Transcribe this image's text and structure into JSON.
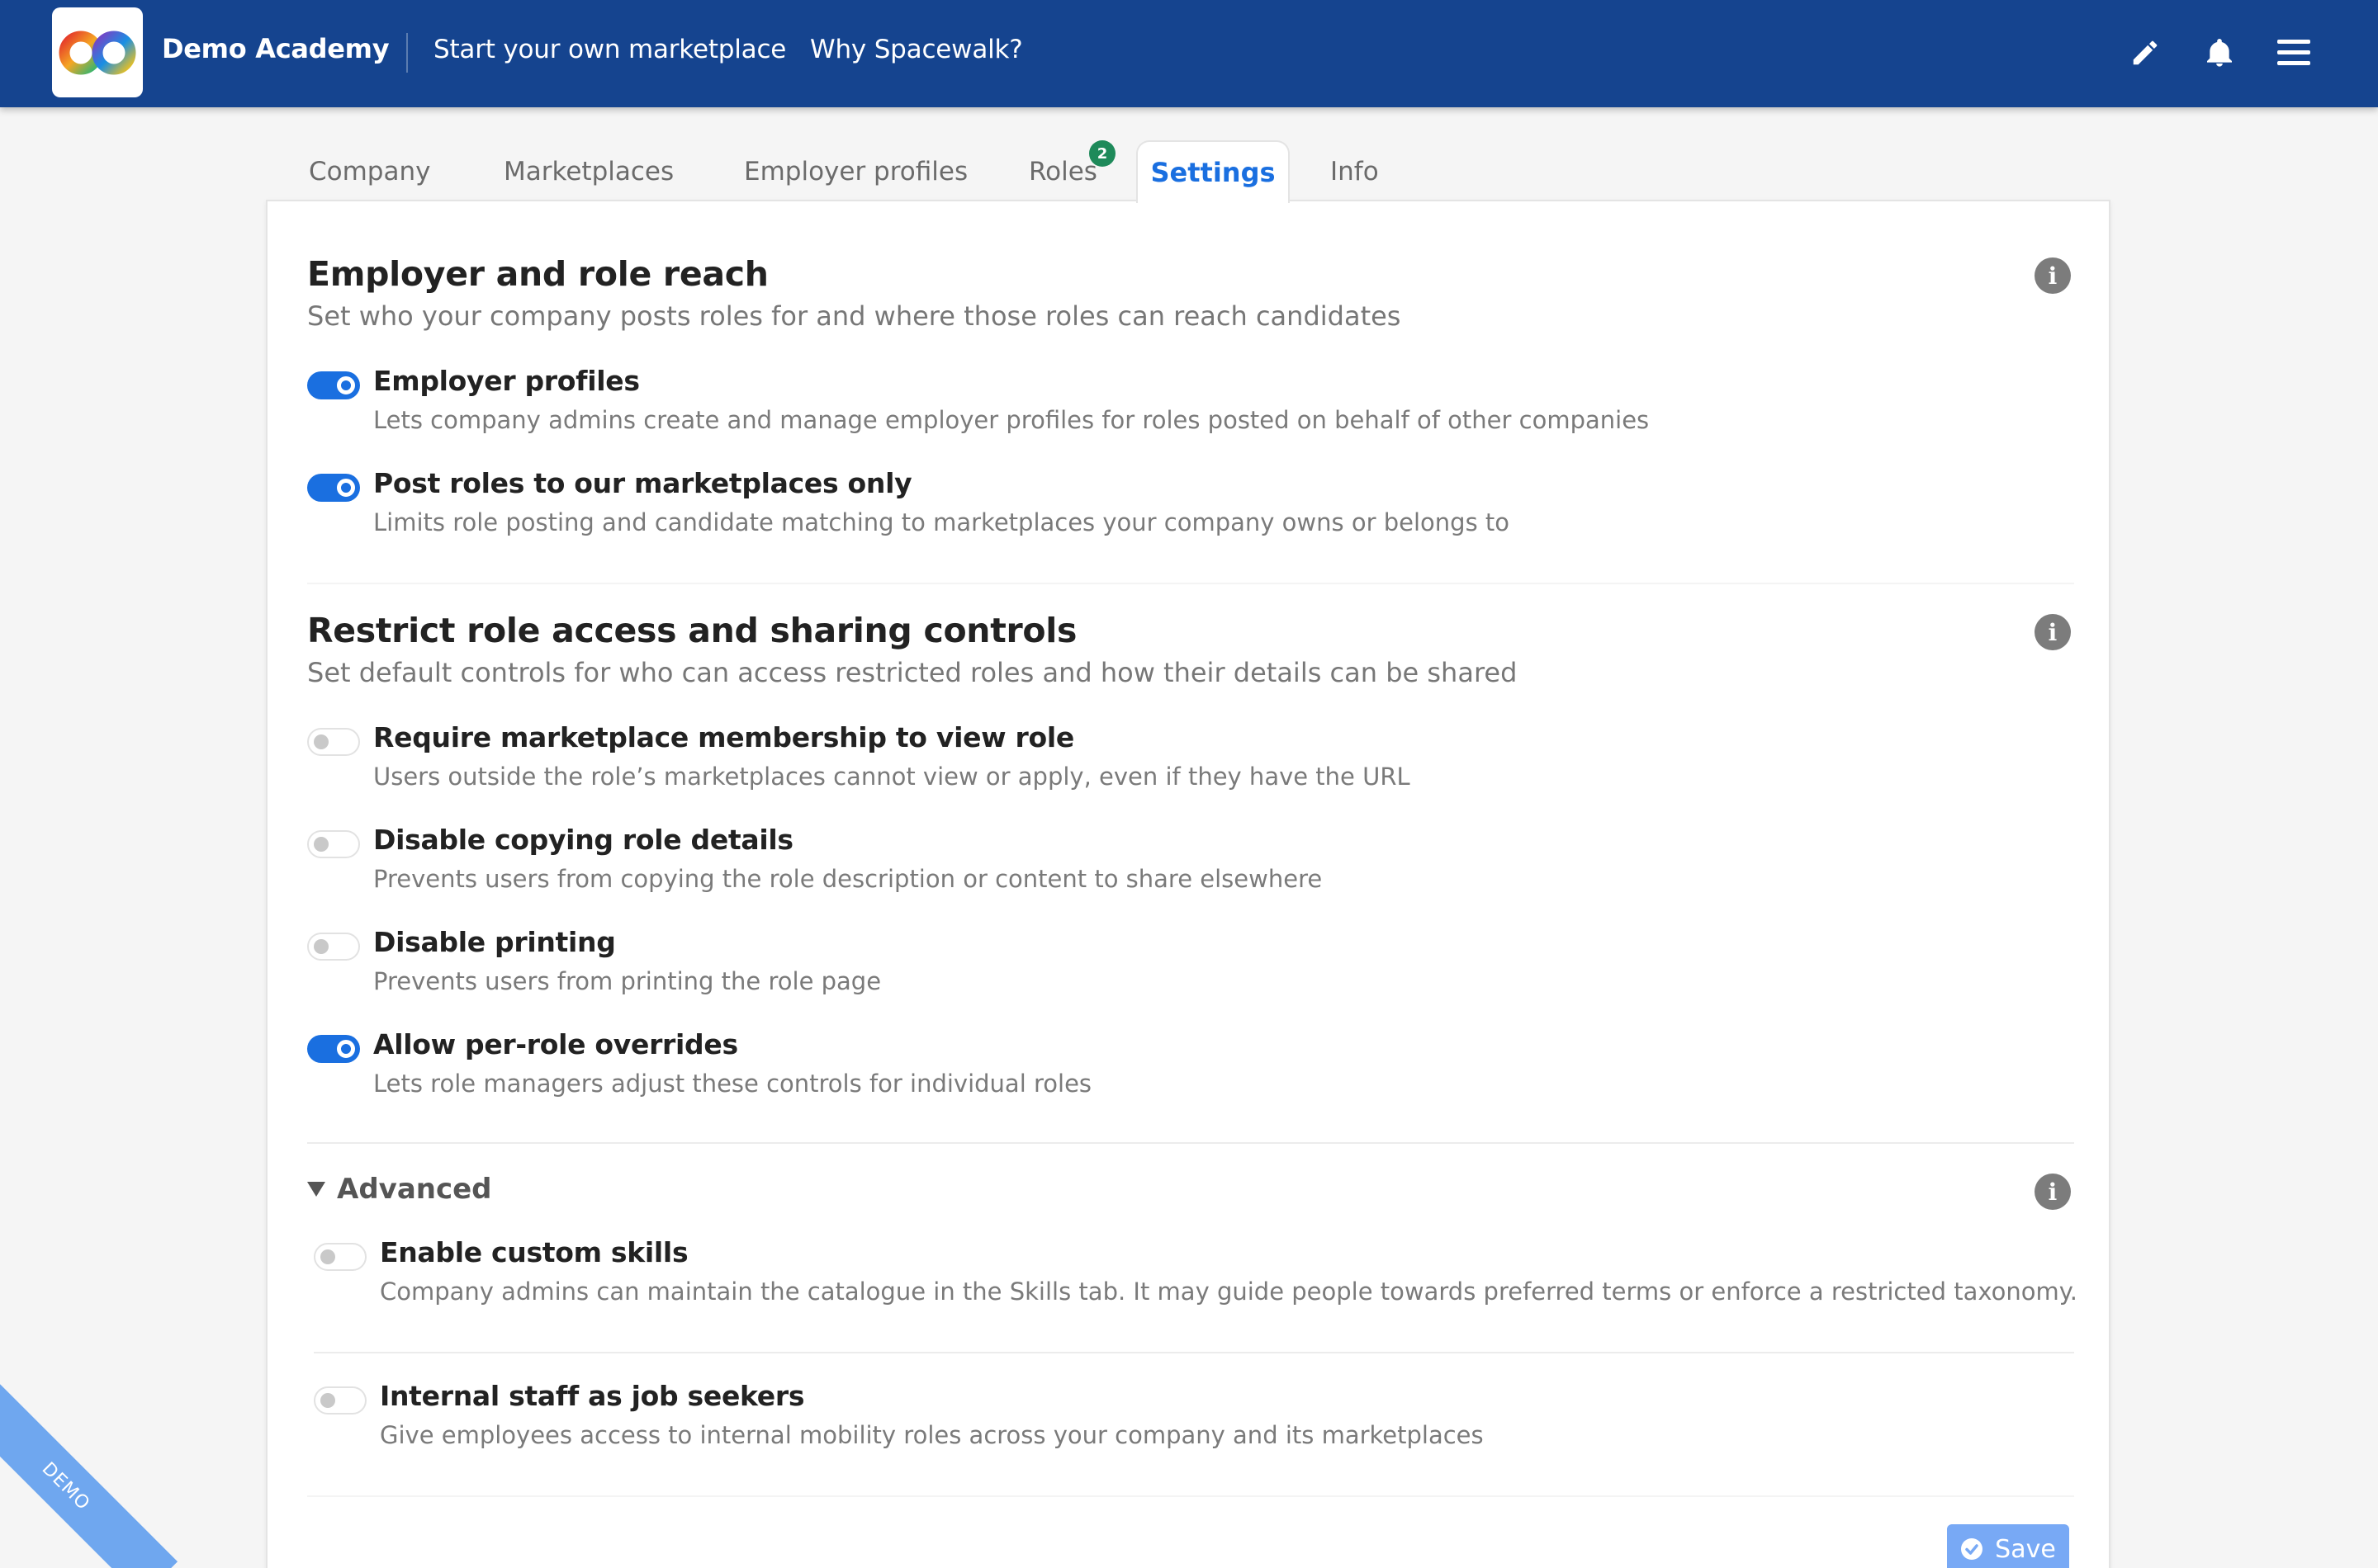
{
  "app": {
    "brand": "Demo Academy",
    "nav": [
      "Start your own marketplace",
      "Why Spacewalk?"
    ],
    "icons": [
      "pencil-icon",
      "bell-icon",
      "menu-icon"
    ]
  },
  "tabs": [
    {
      "label": "Company"
    },
    {
      "label": "Marketplaces"
    },
    {
      "label": "Employer profiles"
    },
    {
      "label": "Roles",
      "badge": "2"
    },
    {
      "label": "Settings",
      "active": true
    },
    {
      "label": "Info"
    }
  ],
  "sections": {
    "reach": {
      "title": "Employer and role reach",
      "subtitle": "Set who your company posts roles for and where those roles can reach candidates",
      "options": [
        {
          "label": "Employer profiles",
          "desc": "Lets company admins create and manage employer profiles for roles posted on behalf of other companies",
          "on": true
        },
        {
          "label": "Post roles to our marketplaces only",
          "desc": "Limits role posting and candidate matching to marketplaces your company owns or belongs to",
          "on": true
        }
      ]
    },
    "access": {
      "title": "Restrict role access and sharing controls",
      "subtitle": "Set default controls for who can access restricted roles and how their details can be shared",
      "options": [
        {
          "label": "Require marketplace membership to view role",
          "desc": "Users outside the role’s marketplaces cannot view or apply, even if they have the URL",
          "on": false
        },
        {
          "label": "Disable copying role details",
          "desc": "Prevents users from copying the role description or content to share elsewhere",
          "on": false
        },
        {
          "label": "Disable printing",
          "desc": "Prevents users from printing the role page",
          "on": false
        },
        {
          "label": "Allow per-role overrides",
          "desc": "Lets role managers adjust these controls for individual roles",
          "on": true
        }
      ]
    },
    "advanced": {
      "title": "Advanced",
      "options": [
        {
          "label": "Enable custom skills",
          "desc": "Company admins can maintain the catalogue in the Skills tab. It may guide people towards preferred terms or enforce a restricted taxonomy.",
          "on": false
        },
        {
          "label": "Internal staff as job seekers",
          "desc": "Give employees access to internal mobility roles across your company and its marketplaces",
          "on": false
        }
      ]
    }
  },
  "save_label": "Save",
  "ribbon_label": "DEMO",
  "colors": {
    "header": "#15448f",
    "accent": "#1a6fe0",
    "badge": "#1e8a5a",
    "save": "#78a9f5"
  }
}
